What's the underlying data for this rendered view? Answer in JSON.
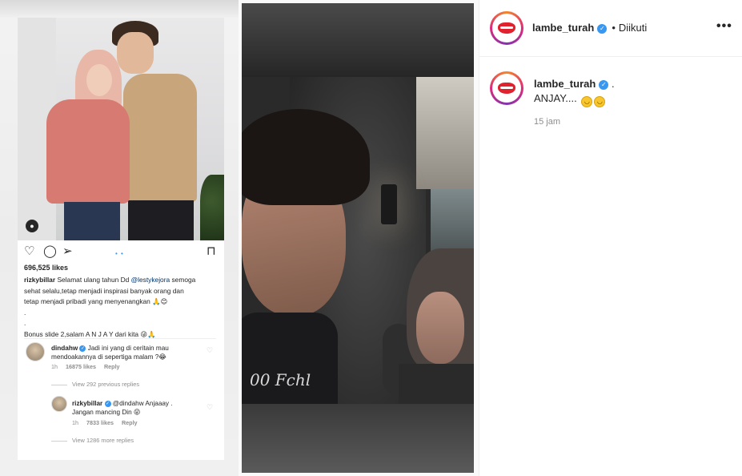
{
  "media": {
    "left_post": {
      "likes": "696,525 likes",
      "caption_user": "rizkybillar",
      "caption_line1_pre": "Selamat ulang tahun Dd ",
      "caption_mention": "@lestykejora",
      "caption_line1_post": " semoga",
      "caption_line2": "sehat selalu,tetap menjadi inspirasi banyak orang dan",
      "caption_line3": "tetap menjadi pribadi yang menyenangkan 🙏😊",
      "caption_dot1": ".",
      "caption_dot2": ".",
      "caption_line4": "Bonus slide 2,salam A N J A Y dari kita 😜🙏",
      "comments": [
        {
          "user": "dindahw",
          "text_line1": "Jadi ini yang di ceritain mau",
          "text_line2": "mendoakannya di sepertiga malam ?😂",
          "time": "1h",
          "likes": "16875 likes",
          "reply": "Reply"
        }
      ],
      "view_previous_replies": "View 292 previous replies",
      "reply": {
        "user": "rizkybillar",
        "text_line1": "@dindahw Anjaaay .",
        "text_line2": "Jangan mancing Din 😜",
        "time": "1h",
        "likes": "7833 likes",
        "reply": "Reply"
      },
      "view_more_replies": "View 1286 more replies"
    },
    "right_video": {
      "shirt_print": "00 Fchl"
    }
  },
  "panel": {
    "header": {
      "username": "lambe_turah",
      "follow_status": "Diikuti",
      "separator": "•",
      "more": "•••"
    },
    "post": {
      "username": "lambe_turah",
      "trailing": ".",
      "caption": "ANJAY....",
      "time": "15 jam"
    }
  },
  "colors": {
    "verified": "#3897f0",
    "text": "#262626",
    "muted": "#8e8e8e",
    "lips": "#e0212e"
  }
}
